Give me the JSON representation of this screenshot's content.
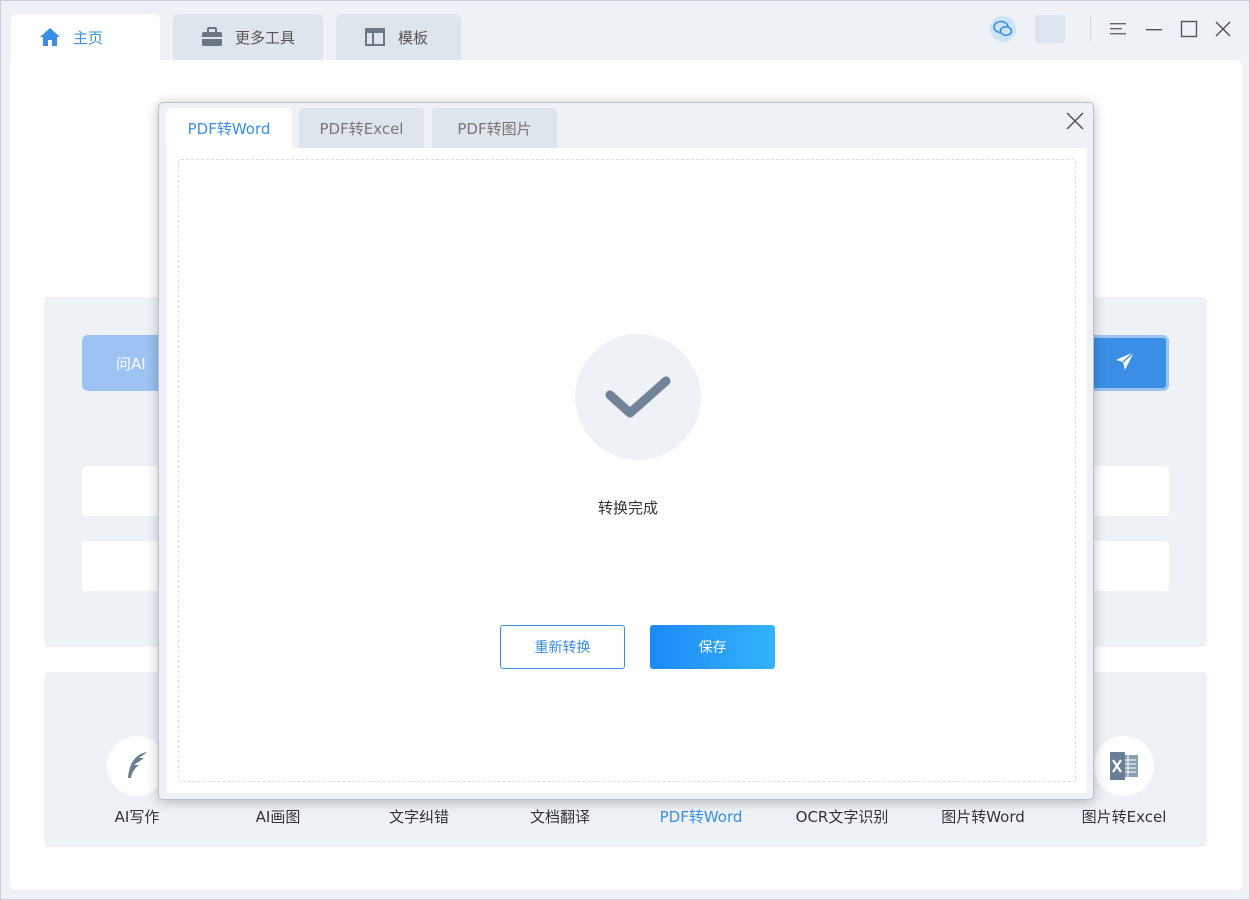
{
  "top_tabs": [
    {
      "label": "主页",
      "icon": "home-icon",
      "active": true
    },
    {
      "label": "更多工具",
      "icon": "briefcase-icon",
      "active": false
    },
    {
      "label": "模板",
      "icon": "template-icon",
      "active": false
    }
  ],
  "window_controls": [
    "wechat-icon",
    "menu-icon",
    "minimize-icon",
    "maximize-icon",
    "close-icon"
  ],
  "chat": {
    "ask_label": "问AI",
    "send_icon": "send-icon"
  },
  "tools": [
    {
      "label": "AI写作",
      "icon": "feather-icon"
    },
    {
      "label": "AI画图",
      "icon": ""
    },
    {
      "label": "文字纠错",
      "icon": ""
    },
    {
      "label": "文档翻译",
      "icon": ""
    },
    {
      "label": "PDF转Word",
      "icon": "",
      "active": true
    },
    {
      "label": "OCR文字识别",
      "icon": ""
    },
    {
      "label": "图片转Word",
      "icon": ""
    },
    {
      "label": "图片转Excel",
      "icon": "excel-icon"
    }
  ],
  "dialog": {
    "tabs": [
      {
        "label": "PDF转Word",
        "active": true
      },
      {
        "label": "PDF转Excel",
        "active": false
      },
      {
        "label": "PDF转图片",
        "active": false
      }
    ],
    "status_text": "转换完成",
    "retry_label": "重新转换",
    "save_label": "保存"
  },
  "colors": {
    "accent": "#3a8ee6",
    "background": "#eef2f7"
  }
}
